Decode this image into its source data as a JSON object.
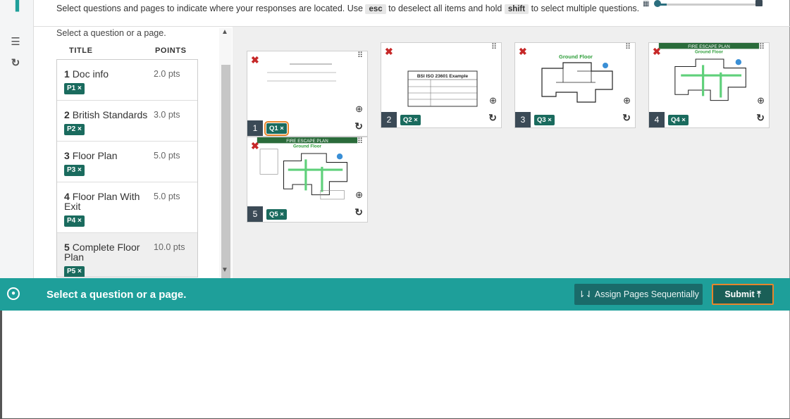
{
  "instruction": {
    "part1": "Select questions and pages to indicate where your responses are located. Use ",
    "key_esc": "esc",
    "part2": " to deselect all items and hold ",
    "key_shift": "shift",
    "part3": " to select multiple questions."
  },
  "zoom": {
    "level": 0.05
  },
  "questions": {
    "hint": "Select a question or a page.",
    "col_title": "TITLE",
    "col_points": "POINTS",
    "items": [
      {
        "num": "1",
        "title": "Doc info",
        "points": "2.0 pts",
        "tag": "P1 ×"
      },
      {
        "num": "2",
        "title": "British Standards",
        "points": "3.0 pts",
        "tag": "P2 ×"
      },
      {
        "num": "3",
        "title": "Floor Plan",
        "points": "5.0 pts",
        "tag": "P3 ×"
      },
      {
        "num": "4",
        "title": "Floor Plan With Exit",
        "points": "5.0 pts",
        "tag": "P4 ×"
      },
      {
        "num": "5",
        "title": "Complete Floor Plan",
        "points": "10.0 pts",
        "tag": "P5 ×"
      }
    ]
  },
  "pages": [
    {
      "num": "1",
      "tag": "Q1 ×"
    },
    {
      "num": "2",
      "tag": "Q2 ×",
      "doc_title": "BSI ISO 23601 Example"
    },
    {
      "num": "3",
      "tag": "Q3 ×",
      "plan_title": "Ground Floor"
    },
    {
      "num": "4",
      "tag": "Q4 ×",
      "banner": "FIRE ESCAPE PLAN",
      "plan_title": "Ground Floor"
    },
    {
      "num": "5",
      "tag": "Q5 ×",
      "banner": "FIRE ESCAPE PLAN",
      "plan_title": "Ground Floor"
    }
  ],
  "bar": {
    "message": "Select a question or a page.",
    "assign_label": "Assign Pages Sequentially",
    "submit_label": "Submit"
  },
  "colors": {
    "teal": "#1e9f9a",
    "tag": "#1a6b5e",
    "highlight": "#e8852b",
    "error_x": "#c62828"
  }
}
